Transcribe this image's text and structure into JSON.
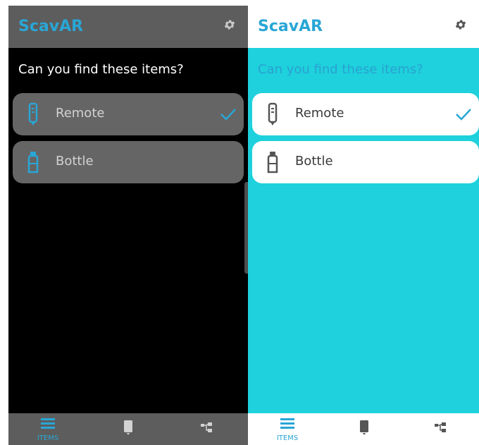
{
  "app": {
    "title": "ScavAR"
  },
  "screen": {
    "prompt": "Can you find these items?"
  },
  "items": [
    {
      "label": "Remote",
      "icon": "remote-icon",
      "found": true
    },
    {
      "label": "Bottle",
      "icon": "bottle-icon",
      "found": false
    }
  ],
  "tabs": [
    {
      "label": "ITEMS",
      "icon": "list-icon",
      "active": true
    },
    {
      "label": "",
      "icon": "phone-icon",
      "active": false
    },
    {
      "label": "",
      "icon": "hierarchy-icon",
      "active": false
    }
  ],
  "colors": {
    "accent": "#29a6d6",
    "light_background": "#1ed1dc",
    "dark_background": "#000000",
    "dark_header": "#5d5d5d",
    "dark_card": "#656565",
    "icon_gray": "#555555"
  }
}
